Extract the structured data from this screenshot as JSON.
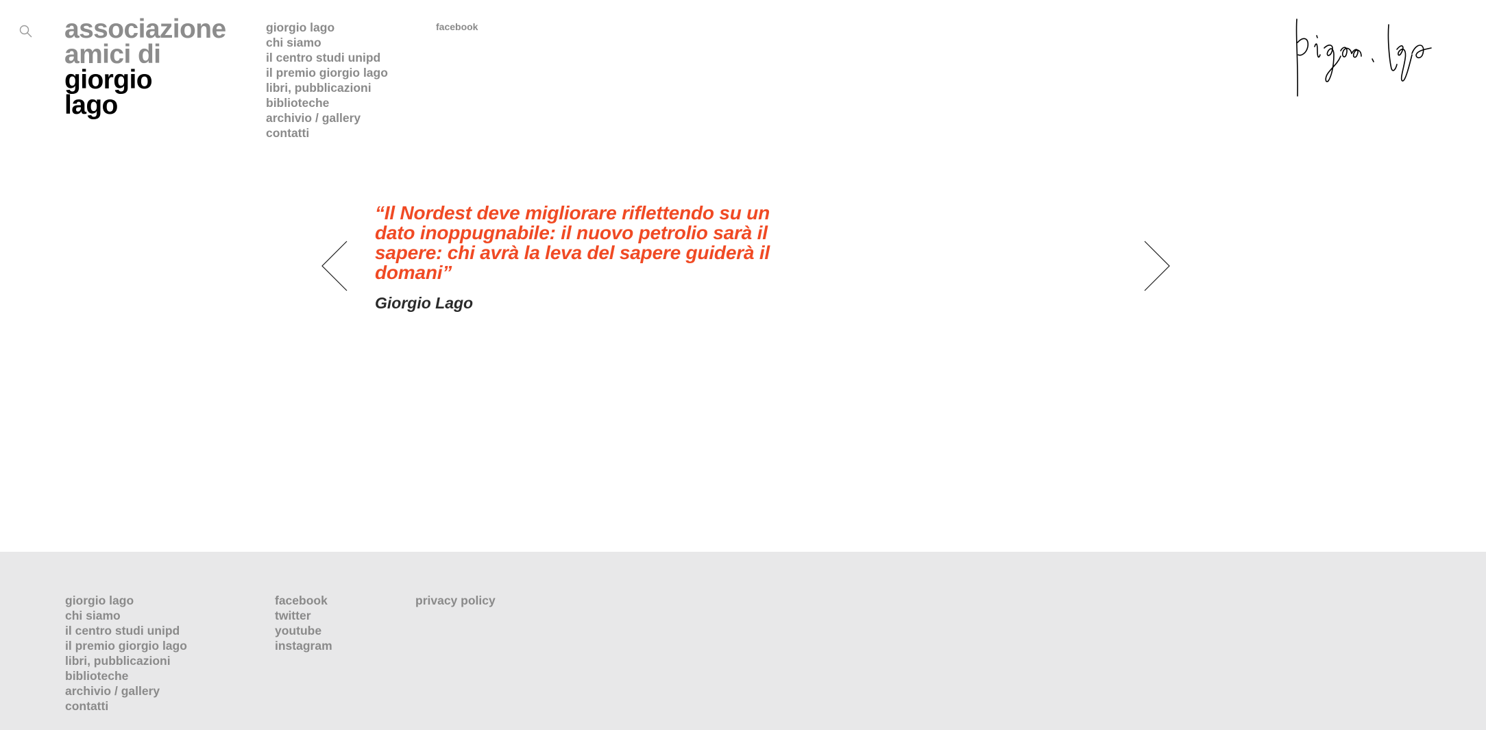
{
  "header": {
    "search_icon": "search-icon",
    "logo": {
      "line1": "associazione",
      "line2": "amici di",
      "line3": "giorgio",
      "line4": "lago"
    },
    "nav": [
      "giorgio lago",
      "chi siamo",
      "il centro studi unipd",
      "il premio giorgio lago",
      "libri, pubblicazioni",
      "biblioteche",
      "archivio / gallery",
      "contatti"
    ],
    "social": "facebook",
    "signature_text": "giorgio lago"
  },
  "slider": {
    "prev_icon": "chevron-left-icon",
    "next_icon": "chevron-right-icon",
    "quote": "“Il Nordest deve migliorare riflettendo su un dato inoppugnabile: il nuovo petrolio sarà il sapere: chi avrà la leva del sapere guiderà il domani”",
    "author": "Giorgio Lago"
  },
  "footer": {
    "nav": [
      "giorgio lago",
      "chi siamo",
      "il centro studi unipd",
      "il premio giorgio lago",
      "libri, pubblicazioni",
      "biblioteche",
      "archivio / gallery",
      "contatti"
    ],
    "social": [
      "facebook",
      "twitter",
      "youtube",
      "instagram"
    ],
    "legal": [
      "privacy policy"
    ]
  },
  "colors": {
    "accent": "#f04a24",
    "nav_grey": "#8a8a8a",
    "footer_bg": "#e8e8e9"
  }
}
